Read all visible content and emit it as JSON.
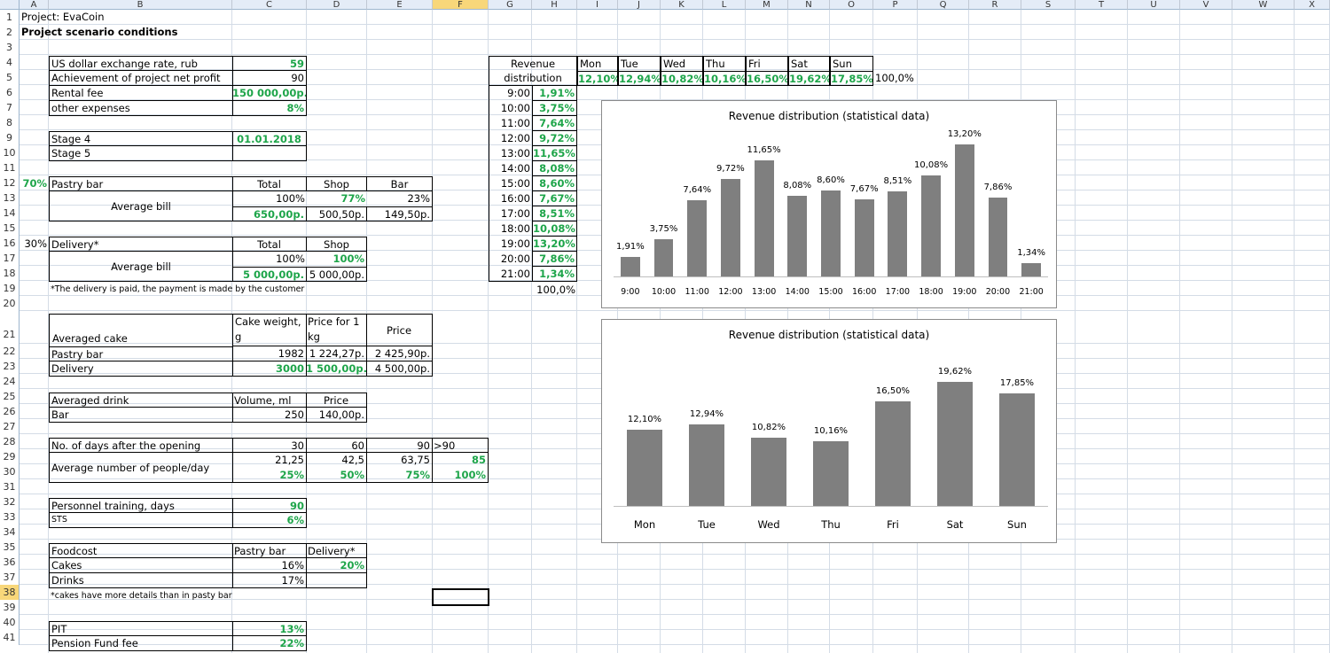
{
  "columns": [
    "A",
    "B",
    "C",
    "D",
    "E",
    "F",
    "G",
    "H",
    "I",
    "J",
    "K",
    "L",
    "M",
    "N",
    "O",
    "P",
    "Q",
    "R",
    "S",
    "T",
    "U",
    "V",
    "W",
    "X"
  ],
  "rows": [
    "1",
    "2",
    "3",
    "4",
    "5",
    "6",
    "7",
    "8",
    "9",
    "10",
    "11",
    "12",
    "13",
    "14",
    "15",
    "16",
    "17",
    "18",
    "19",
    "20",
    "21",
    "22",
    "23",
    "24",
    "25",
    "26",
    "27",
    "28",
    "29",
    "30",
    "31",
    "32",
    "33",
    "34",
    "35",
    "36",
    "37",
    "38",
    "39",
    "40",
    "41"
  ],
  "sheet": {
    "project": "Project: EvaCoin",
    "conditions": "Project scenario conditions",
    "params": [
      {
        "label": "US dollar exchange rate, rub",
        "value": "59"
      },
      {
        "label": "Achievement of project net profit",
        "value": "90"
      },
      {
        "label": "Rental fee",
        "value": "150 000,00р."
      },
      {
        "label": "other expenses",
        "value": "8%"
      }
    ],
    "stages": [
      {
        "label": "Stage 4",
        "value": "01.01.2018"
      },
      {
        "label": "Stage 5",
        "value": ""
      }
    ],
    "pastry": {
      "pct": "70%",
      "label": "Pastry bar",
      "total": "Total",
      "shop": "Shop",
      "bar": "Bar",
      "avg_label": "Average bill",
      "total_pct": "100%",
      "shop_pct": "77%",
      "bar_pct": "23%",
      "total_val": "650,00р.",
      "shop_val": "500,50р.",
      "bar_val": "149,50р."
    },
    "delivery": {
      "pct": "30%",
      "label": "Delivery*",
      "total": "Total",
      "shop": "Shop",
      "avg_label": "Average bill",
      "total_pct": "100%",
      "shop_pct": "100%",
      "total_val": "5 000,00р.",
      "shop_val": "5 000,00р.",
      "note": "*The delivery is paid, the payment is made by the customer"
    },
    "cake": {
      "weight_hdr": "Cake weight, g",
      "pricekg_hdr": "Price for 1 kg",
      "price_hdr": "Price",
      "label": "Averaged cake",
      "pastry_label": "Pastry bar",
      "pastry_weight": "1982",
      "pastry_pricekg": "1 224,27р.",
      "pastry_price": "2 425,90р.",
      "delivery_label": "Delivery",
      "delivery_weight": "3000",
      "delivery_pricekg": "1 500,00р.",
      "delivery_price": "4 500,00р."
    },
    "drink": {
      "label": "Averaged drink",
      "volume_hdr": "Volume, ml",
      "price_hdr": "Price",
      "bar_label": "Bar",
      "bar_volume": "250",
      "bar_price": "140,00р."
    },
    "days": {
      "label": "No. of days after the opening",
      "d1": "30",
      "d2": "60",
      "d3": "90",
      "d4": ">90",
      "people_label": "Average number of people/day",
      "p1": "21,25",
      "p2": "42,5",
      "p3": "63,75",
      "p4": "85",
      "q1": "25%",
      "q2": "50%",
      "q3": "75%",
      "q4": "100%"
    },
    "training": {
      "label": "Personnel training, days",
      "value": "90",
      "sts_label": "STS",
      "sts_value": "6%"
    },
    "foodcost": {
      "label": "Foodcost",
      "pastry_hdr": "Pastry bar",
      "delivery_hdr": "Delivery*",
      "cakes_label": "Cakes",
      "cakes_pastry": "16%",
      "cakes_delivery": "20%",
      "drinks_label": "Drinks",
      "drinks_pastry": "17%",
      "note": "*cakes have more details than in pasty bar"
    },
    "taxes": [
      {
        "label": "PIT",
        "value": "13%"
      },
      {
        "label": "Pension Fund fee",
        "value": "22%"
      }
    ],
    "revenue": {
      "header1": "Revenue",
      "header2": "distribution",
      "total": "100,0%",
      "hours": [
        {
          "h": "9:00",
          "v": "1,91%"
        },
        {
          "h": "10:00",
          "v": "3,75%"
        },
        {
          "h": "11:00",
          "v": "7,64%"
        },
        {
          "h": "12:00",
          "v": "9,72%"
        },
        {
          "h": "13:00",
          "v": "11,65%"
        },
        {
          "h": "14:00",
          "v": "8,08%"
        },
        {
          "h": "15:00",
          "v": "8,60%"
        },
        {
          "h": "16:00",
          "v": "7,67%"
        },
        {
          "h": "17:00",
          "v": "8,51%"
        },
        {
          "h": "18:00",
          "v": "10,08%"
        },
        {
          "h": "19:00",
          "v": "13,20%"
        },
        {
          "h": "20:00",
          "v": "7,86%"
        },
        {
          "h": "21:00",
          "v": "1,34%"
        }
      ],
      "days": [
        {
          "d": "Mon",
          "v": "12,10%"
        },
        {
          "d": "Tue",
          "v": "12,94%"
        },
        {
          "d": "Wed",
          "v": "10,82%"
        },
        {
          "d": "Thu",
          "v": "10,16%"
        },
        {
          "d": "Fri",
          "v": "16,50%"
        },
        {
          "d": "Sat",
          "v": "19,62%"
        },
        {
          "d": "Sun",
          "v": "17,85%"
        }
      ],
      "days_total": "100,0%"
    }
  },
  "colors": {
    "green": "#1ea54a",
    "bar": "#7f7f7f",
    "grid": "#d4dce6",
    "header": "#e4ecf7",
    "selected": "#f8d77a"
  },
  "chart_data": [
    {
      "type": "bar",
      "title": "Revenue distribution (statistical data)",
      "categories": [
        "9:00",
        "10:00",
        "11:00",
        "12:00",
        "13:00",
        "14:00",
        "15:00",
        "16:00",
        "17:00",
        "18:00",
        "19:00",
        "20:00",
        "21:00"
      ],
      "values": [
        1.91,
        3.75,
        7.64,
        9.72,
        11.65,
        8.08,
        8.6,
        7.67,
        8.51,
        10.08,
        13.2,
        7.86,
        1.34
      ],
      "labels": [
        "1,91%",
        "3,75%",
        "7,64%",
        "9,72%",
        "11,65%",
        "8,08%",
        "8,60%",
        "7,67%",
        "8,51%",
        "10,08%",
        "13,20%",
        "7,86%",
        "1,34%"
      ],
      "ylim": [
        0,
        14
      ]
    },
    {
      "type": "bar",
      "title": "Revenue distribution (statistical data)",
      "categories": [
        "Mon",
        "Tue",
        "Wed",
        "Thu",
        "Fri",
        "Sat",
        "Sun"
      ],
      "values": [
        12.1,
        12.94,
        10.82,
        10.16,
        16.5,
        19.62,
        17.85
      ],
      "labels": [
        "12,10%",
        "12,94%",
        "10,82%",
        "10,16%",
        "16,50%",
        "19,62%",
        "17,85%"
      ],
      "ylim": [
        0,
        21
      ]
    }
  ]
}
